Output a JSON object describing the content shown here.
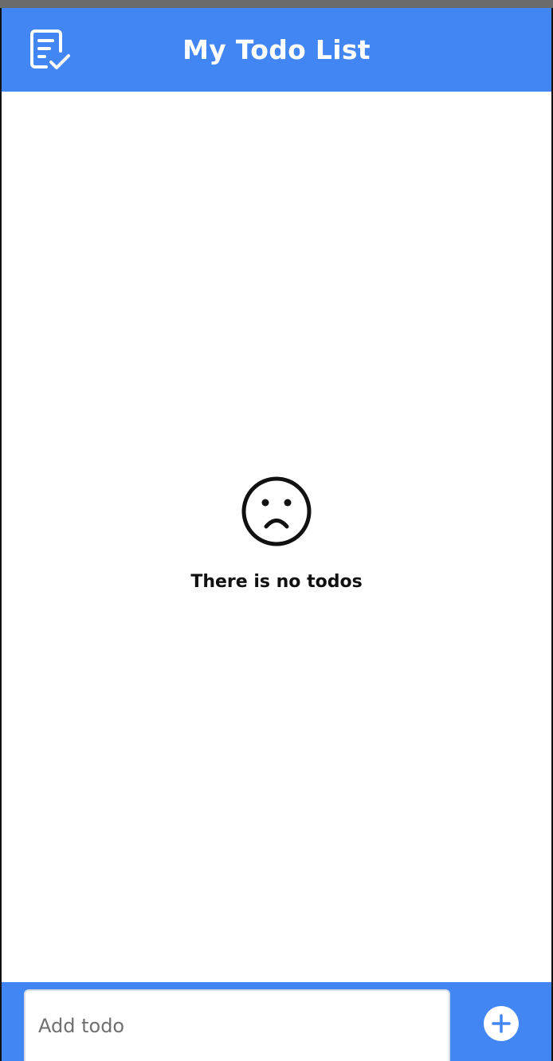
{
  "header": {
    "title": "My Todo List",
    "icon": "checklist-icon",
    "background_color": "#4286f4"
  },
  "empty_state": {
    "icon": "sad-face-icon",
    "message": "There is no todos"
  },
  "composer": {
    "input_placeholder": "Add todo",
    "input_value": "",
    "add_button_icon": "plus-icon",
    "background_color": "#4286f4"
  }
}
